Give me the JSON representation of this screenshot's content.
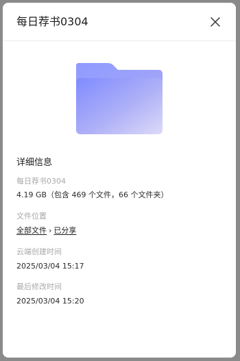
{
  "header": {
    "title": "每日荐书0304",
    "close_icon": "close-icon"
  },
  "folder_icon": "folder-icon",
  "details": {
    "section_title": "详细信息",
    "name_label": "每日荐书0304",
    "size_value": "4.19 GB（包含 469 个文件，66 个文件夹）",
    "location_label": "文件位置",
    "location_path": [
      "全部文件",
      "已分享"
    ],
    "location_separator": "›",
    "created_label": "云端创建时间",
    "created_value": "2025/03/04 15:17",
    "modified_label": "最后修改时间",
    "modified_value": "2025/03/04 15:20"
  },
  "colors": {
    "folder_back": "#8f9cff",
    "folder_front": "#c9c8f7"
  }
}
